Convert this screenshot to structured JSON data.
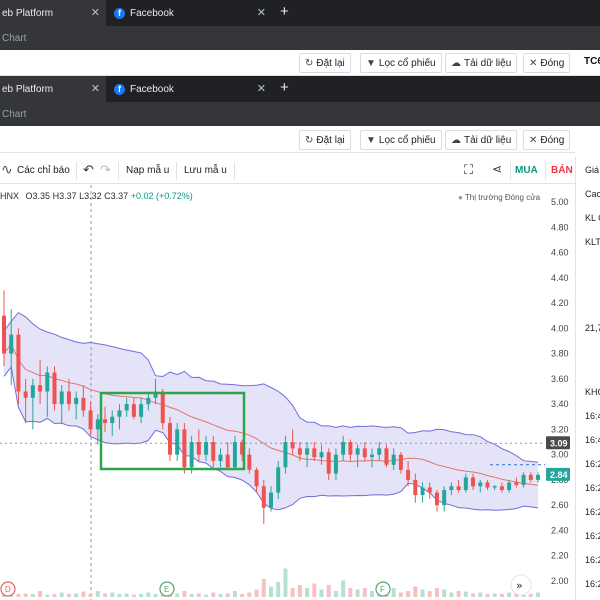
{
  "browser_top": {
    "tab_active": "eb Platform",
    "tab_facebook": "Facebook",
    "address": "Chart"
  },
  "toolbar_top": {
    "dat_lai": "Đặt lại",
    "loc_co_phieu": "Lọc cổ phiếu",
    "tai_du_lieu": "Tải dữ liệu",
    "dong": "Đóng",
    "symbol_cut": "TC6"
  },
  "browser_second": {
    "tab_active": "eb Platform",
    "tab_facebook": "Facebook",
    "address": "Chart"
  },
  "toolbar_second": {
    "dat_lai": "Đặt lại",
    "loc_co_phieu": "Lọc cổ phiếu",
    "tai_du_lieu": "Tải dữ liệu",
    "dong": "Đóng"
  },
  "chart_toolbar": {
    "indicators": "Các chỉ báo",
    "load_template": "Nạp mẫ u",
    "save_template": "Lưu mẫ u",
    "buy": "MUA",
    "sell": "BÁN"
  },
  "legend": {
    "exchange": "HNX",
    "open": "O3.35",
    "high": "H3.37",
    "low": "L3.32",
    "close": "C3.37",
    "change": "+0.02 (+0.72%)",
    "market_status": "Thị trường Đóng cửa"
  },
  "right_panel": {
    "labels": [
      "Giá",
      "Cao",
      "KL C",
      "KLT",
      "21,7",
      "KHC",
      "16:4",
      "16:4",
      "16:2",
      "16:2",
      "16:2",
      "16:2",
      "16:2",
      "16:2",
      "16:2",
      "16:2",
      "16:2"
    ]
  },
  "markers": {
    "d": "D",
    "e": "E",
    "f": "F",
    "scroll": "»"
  },
  "colors": {
    "up": "#26a69a",
    "down": "#ef5350",
    "band_fill": "#dcd9f4",
    "band_line": "#6f6fdc",
    "sma": "#e5746d",
    "highlight_box": "#2ea44f"
  },
  "chart_data": {
    "type": "candlestick",
    "y_axis_ticks": [
      "5.00",
      "4.80",
      "4.60",
      "4.40",
      "4.20",
      "4.00",
      "3.80",
      "3.60",
      "3.40",
      "3.20",
      "3.00",
      "2.80",
      "2.60",
      "2.40",
      "2.20",
      "2.00"
    ],
    "ylim": [
      1.98,
      5.05
    ],
    "price_line_label": "3.09",
    "last_price_label": "2.84",
    "ohlc": [
      [
        4.1,
        4.3,
        3.7,
        3.8
      ],
      [
        3.8,
        4.15,
        3.55,
        3.95
      ],
      [
        3.95,
        4.0,
        3.4,
        3.5
      ],
      [
        3.5,
        3.6,
        3.25,
        3.45
      ],
      [
        3.45,
        3.6,
        3.2,
        3.55
      ],
      [
        3.55,
        3.75,
        3.4,
        3.5
      ],
      [
        3.5,
        3.7,
        3.3,
        3.65
      ],
      [
        3.65,
        3.7,
        3.35,
        3.4
      ],
      [
        3.4,
        3.55,
        3.25,
        3.5
      ],
      [
        3.5,
        3.6,
        3.35,
        3.4
      ],
      [
        3.4,
        3.5,
        3.28,
        3.45
      ],
      [
        3.45,
        3.55,
        3.3,
        3.35
      ],
      [
        3.35,
        3.42,
        3.15,
        3.2
      ],
      [
        3.2,
        3.32,
        3.08,
        3.28
      ],
      [
        3.28,
        3.38,
        3.18,
        3.25
      ],
      [
        3.25,
        3.35,
        3.15,
        3.3
      ],
      [
        3.3,
        3.4,
        3.2,
        3.35
      ],
      [
        3.35,
        3.45,
        3.3,
        3.4
      ],
      [
        3.4,
        3.45,
        3.28,
        3.3
      ],
      [
        3.3,
        3.45,
        3.25,
        3.4
      ],
      [
        3.4,
        3.5,
        3.35,
        3.45
      ],
      [
        3.45,
        3.6,
        3.4,
        3.5
      ],
      [
        3.5,
        3.52,
        3.2,
        3.25
      ],
      [
        3.25,
        3.3,
        2.95,
        3.0
      ],
      [
        3.0,
        3.25,
        2.95,
        3.2
      ],
      [
        3.2,
        3.25,
        2.85,
        2.9
      ],
      [
        2.9,
        3.15,
        2.85,
        3.1
      ],
      [
        3.1,
        3.2,
        2.95,
        3.0
      ],
      [
        3.0,
        3.15,
        2.95,
        3.1
      ],
      [
        3.1,
        3.15,
        2.9,
        2.95
      ],
      [
        2.95,
        3.05,
        2.9,
        3.0
      ],
      [
        3.0,
        3.1,
        2.88,
        2.9
      ],
      [
        2.9,
        3.15,
        2.88,
        3.1
      ],
      [
        3.1,
        3.12,
        2.95,
        3.0
      ],
      [
        3.0,
        3.05,
        2.85,
        2.88
      ],
      [
        2.88,
        2.9,
        2.7,
        2.75
      ],
      [
        2.75,
        2.8,
        2.45,
        2.58
      ],
      [
        2.58,
        2.75,
        2.55,
        2.7
      ],
      [
        2.7,
        2.95,
        2.65,
        2.9
      ],
      [
        2.9,
        3.15,
        2.85,
        3.1
      ],
      [
        3.1,
        3.2,
        3.0,
        3.05
      ],
      [
        3.05,
        3.1,
        2.95,
        3.0
      ],
      [
        3.0,
        3.1,
        2.9,
        3.05
      ],
      [
        3.05,
        3.1,
        2.95,
        2.98
      ],
      [
        2.98,
        3.08,
        2.92,
        3.02
      ],
      [
        3.02,
        3.05,
        2.8,
        2.85
      ],
      [
        2.85,
        3.05,
        2.8,
        3.0
      ],
      [
        3.0,
        3.15,
        2.95,
        3.1
      ],
      [
        3.1,
        3.12,
        2.95,
        3.0
      ],
      [
        3.0,
        3.08,
        2.9,
        3.05
      ],
      [
        3.05,
        3.1,
        2.95,
        2.98
      ],
      [
        2.98,
        3.05,
        2.9,
        3.0
      ],
      [
        3.0,
        3.1,
        2.95,
        3.05
      ],
      [
        3.05,
        3.08,
        2.9,
        2.92
      ],
      [
        2.92,
        3.05,
        2.88,
        3.0
      ],
      [
        3.0,
        3.02,
        2.85,
        2.88
      ],
      [
        2.88,
        2.95,
        2.75,
        2.8
      ],
      [
        2.8,
        2.85,
        2.62,
        2.68
      ],
      [
        2.68,
        2.78,
        2.62,
        2.74
      ],
      [
        2.74,
        2.78,
        2.65,
        2.7
      ],
      [
        2.7,
        2.72,
        2.55,
        2.6
      ],
      [
        2.6,
        2.75,
        2.55,
        2.72
      ],
      [
        2.72,
        2.78,
        2.68,
        2.75
      ],
      [
        2.75,
        2.8,
        2.7,
        2.72
      ],
      [
        2.72,
        2.85,
        2.7,
        2.82
      ],
      [
        2.82,
        2.85,
        2.72,
        2.75
      ],
      [
        2.75,
        2.8,
        2.7,
        2.78
      ],
      [
        2.78,
        2.8,
        2.72,
        2.74
      ],
      [
        2.74,
        2.76,
        2.72,
        2.75
      ],
      [
        2.75,
        2.78,
        2.7,
        2.72
      ],
      [
        2.72,
        2.8,
        2.7,
        2.78
      ],
      [
        2.78,
        2.82,
        2.74,
        2.76
      ],
      [
        2.76,
        2.86,
        2.74,
        2.84
      ],
      [
        2.84,
        2.86,
        2.78,
        2.8
      ],
      [
        2.8,
        2.86,
        2.78,
        2.84
      ]
    ],
    "volume_relative": [
      0.3,
      0.15,
      0.1,
      0.12,
      0.1,
      0.2,
      0.08,
      0.1,
      0.15,
      0.1,
      0.12,
      0.18,
      0.1,
      0.2,
      0.12,
      0.15,
      0.1,
      0.12,
      0.08,
      0.1,
      0.15,
      0.1,
      0.2,
      0.25,
      0.12,
      0.2,
      0.1,
      0.12,
      0.08,
      0.15,
      0.1,
      0.12,
      0.2,
      0.1,
      0.15,
      0.25,
      0.6,
      0.35,
      0.5,
      0.95,
      0.3,
      0.4,
      0.3,
      0.45,
      0.25,
      0.4,
      0.2,
      0.55,
      0.3,
      0.25,
      0.3,
      0.2,
      0.25,
      0.2,
      0.3,
      0.15,
      0.2,
      0.35,
      0.25,
      0.2,
      0.3,
      0.25,
      0.15,
      0.2,
      0.18,
      0.12,
      0.15,
      0.1,
      0.12,
      0.1,
      0.15,
      0.12,
      0.18,
      0.1,
      0.15
    ]
  }
}
